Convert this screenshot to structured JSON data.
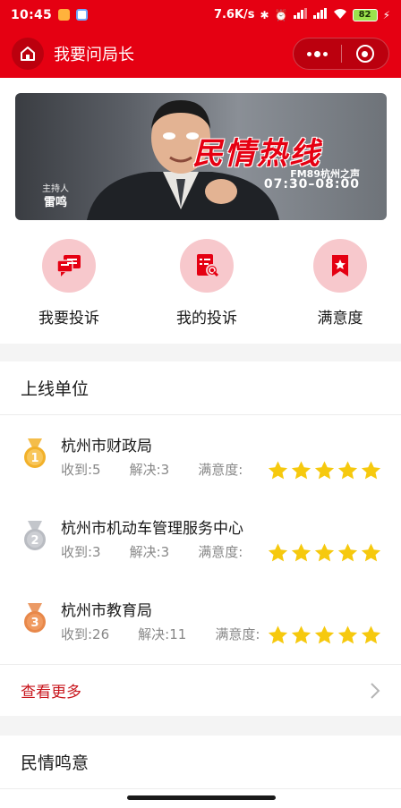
{
  "status_bar": {
    "time": "10:45",
    "network_speed": "7.6K/s",
    "battery": "82"
  },
  "nav": {
    "title": "我要问局长"
  },
  "banner": {
    "title": "民情热线",
    "station": "FM89杭州之声",
    "time": "07:30–08:00",
    "host_label": "主持人",
    "host_name": "雷鸣"
  },
  "menu": [
    {
      "label": "我要投诉",
      "icon": "complaint-icon"
    },
    {
      "label": "我的投诉",
      "icon": "document-search-icon"
    },
    {
      "label": "满意度",
      "icon": "bookmark-star-icon"
    }
  ],
  "units": {
    "title": "上线单位",
    "items": [
      {
        "rank": "1",
        "name": "杭州市财政局",
        "received": "收到:5",
        "resolved": "解决:3",
        "satisfaction_label": "满意度:",
        "rating": 5,
        "medal": "gold"
      },
      {
        "rank": "2",
        "name": "杭州市机动车管理服务中心",
        "received": "收到:3",
        "resolved": "解决:3",
        "satisfaction_label": "满意度:",
        "rating": 5,
        "medal": "silver"
      },
      {
        "rank": "3",
        "name": "杭州市教育局",
        "received": "收到:26",
        "resolved": "解决:11",
        "satisfaction_label": "满意度:",
        "rating": 5,
        "medal": "bronze"
      }
    ],
    "more_label": "查看更多"
  },
  "opinion": {
    "title": "民情鸣意"
  },
  "colors": {
    "brand_red": "#e50012",
    "star": "#f6c90e",
    "gold": "#f2b12a",
    "silver": "#b9bcc2",
    "bronze": "#e8884a"
  }
}
